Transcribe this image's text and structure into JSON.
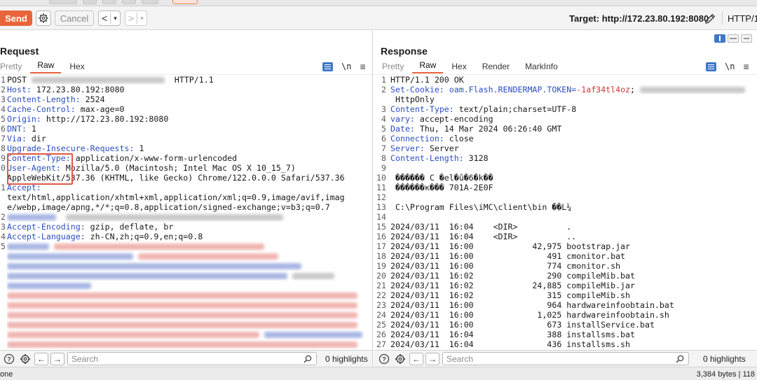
{
  "toolbar": {
    "send_label": "Send",
    "cancel_label": "Cancel",
    "back_label": "<",
    "back_dropdown": "▾",
    "forward_label": ">",
    "forward_dropdown": "▾",
    "target_text": "Target: http://172.23.80.192:8080",
    "http_version": "HTTP/1"
  },
  "request": {
    "title": "Request",
    "tabs": [
      {
        "label": "Pretty",
        "active": false
      },
      {
        "label": "Raw",
        "active": true
      },
      {
        "label": "Hex",
        "active": false
      }
    ],
    "newline_toggle": "\\n",
    "lines": [
      {
        "n": "1",
        "parts": [
          {
            "t": "POST ",
            "c": "hv"
          },
          {
            "blur": "gray",
            "w": 190
          },
          {
            "t": "  HTTP/1.1",
            "c": "hv"
          }
        ]
      },
      {
        "n": "2",
        "parts": [
          {
            "t": "Host:",
            "c": "hn"
          },
          {
            "t": " 172.23.80.192:8080",
            "c": "hv"
          }
        ]
      },
      {
        "n": "3",
        "parts": [
          {
            "t": "Content-Length:",
            "c": "hn"
          },
          {
            "t": " 2524",
            "c": "hv"
          }
        ]
      },
      {
        "n": "4",
        "parts": [
          {
            "t": "Cache-Control:",
            "c": "hn"
          },
          {
            "t": " max-age=0",
            "c": "hv"
          }
        ]
      },
      {
        "n": "5",
        "parts": [
          {
            "t": "Origin:",
            "c": "hn"
          },
          {
            "t": " http://172.23.80.192:8080",
            "c": "hv"
          }
        ]
      },
      {
        "n": "6",
        "parts": [
          {
            "t": "DNT:",
            "c": "hn"
          },
          {
            "t": " 1",
            "c": "hv"
          }
        ]
      },
      {
        "n": "7",
        "parts": [
          {
            "t": "Via:",
            "c": "hn"
          },
          {
            "t": " dir",
            "c": "hv"
          }
        ]
      },
      {
        "n": "8",
        "parts": [
          {
            "t": "Upgrade-Insecure-Requests:",
            "c": "hn"
          },
          {
            "t": " 1",
            "c": "hv"
          }
        ]
      },
      {
        "n": "9",
        "parts": [
          {
            "t": "Content-Type:",
            "c": "hn"
          },
          {
            "t": " application/x-www-form-urlencoded",
            "c": "hv"
          }
        ]
      },
      {
        "n": "0",
        "parts": [
          {
            "t": "User-Agent:",
            "c": "hn"
          },
          {
            "t": " Mozilla/5.0 (Macintosh; Intel Mac OS X 10_15_7)",
            "c": "hv"
          }
        ]
      },
      {
        "n": "",
        "parts": [
          {
            "t": "AppleWebKit/537.36 (KHTML, like Gecko) Chrome/122.0.0.0 Safari/537.36",
            "c": "hv"
          }
        ]
      },
      {
        "n": "1",
        "parts": [
          {
            "t": "Accept:",
            "c": "hn"
          }
        ]
      },
      {
        "n": "",
        "parts": [
          {
            "t": "text/html,application/xhtml+xml,application/xml;q=0.9,image/avif,imag",
            "c": "hv"
          }
        ]
      },
      {
        "n": "",
        "parts": [
          {
            "t": "e/webp,image/apng,*/*;q=0.8,application/signed-exchange;v=b3;q=0.7",
            "c": "hv"
          }
        ]
      },
      {
        "n": "2",
        "parts": [
          {
            "blur": "blue",
            "w": 70
          },
          {
            "t": "  ",
            "c": "hv"
          },
          {
            "blur": "gray",
            "w": 310
          }
        ]
      },
      {
        "n": "3",
        "parts": [
          {
            "t": "Accept-Encoding:",
            "c": "hn"
          },
          {
            "t": " gzip, deflate, br",
            "c": "hv"
          }
        ]
      },
      {
        "n": "4",
        "parts": [
          {
            "t": "Accept-Language:",
            "c": "hn"
          },
          {
            "t": " zh-CN,zh;q=0.9,en;q=0.8",
            "c": "hv"
          }
        ]
      },
      {
        "n": "5",
        "parts": [
          {
            "blur": "blue",
            "w": 60
          },
          {
            "t": " ",
            "c": "hv"
          },
          {
            "blur": "red",
            "w": 300
          }
        ]
      },
      {
        "n": "",
        "parts": [
          {
            "blur": "blue",
            "w": 180
          },
          {
            "t": " ",
            "c": "hv"
          },
          {
            "blur": "red",
            "w": 200
          }
        ]
      },
      {
        "n": "",
        "parts": [
          {
            "blur": "blue",
            "w": 420
          }
        ]
      },
      {
        "n": "",
        "parts": [
          {
            "blur": "blue",
            "w": 400
          },
          {
            "t": " ",
            "c": "hv"
          },
          {
            "blur": "gray",
            "w": 60
          }
        ]
      },
      {
        "n": "",
        "parts": [
          {
            "blur": "blue",
            "w": 120
          }
        ]
      },
      {
        "n": "",
        "parts": [
          {
            "blur": "red",
            "w": 500
          }
        ]
      },
      {
        "n": "",
        "parts": [
          {
            "blur": "red",
            "w": 500
          }
        ]
      },
      {
        "n": "",
        "parts": [
          {
            "blur": "red",
            "w": 500
          }
        ]
      },
      {
        "n": "",
        "parts": [
          {
            "blur": "red",
            "w": 500
          }
        ]
      },
      {
        "n": "",
        "parts": [
          {
            "blur": "red",
            "w": 360
          },
          {
            "t": " ",
            "c": "hv"
          },
          {
            "blur": "blue",
            "w": 140
          }
        ]
      },
      {
        "n": "",
        "parts": [
          {
            "blur": "red",
            "w": 500
          }
        ]
      },
      {
        "n": "",
        "parts": [
          {
            "blur": "red",
            "w": 500
          }
        ]
      }
    ]
  },
  "response": {
    "title": "Response",
    "tabs": [
      {
        "label": "Pretty",
        "active": false
      },
      {
        "label": "Raw",
        "active": true
      },
      {
        "label": "Hex",
        "active": false
      },
      {
        "label": "Render",
        "active": false
      },
      {
        "label": "MarkInfo",
        "active": false
      }
    ],
    "newline_toggle": "\\n",
    "lines": [
      {
        "n": "1",
        "parts": [
          {
            "t": "HTTP/1.1 200 OK",
            "c": "hv"
          }
        ]
      },
      {
        "n": "2",
        "parts": [
          {
            "t": "Set-Cookie:",
            "c": "hn"
          },
          {
            "t": " oam.Flash.RENDERMAP.TOKEN=",
            "c": "hn"
          },
          {
            "t": "-1af34tl4oz",
            "c": "cv"
          },
          {
            "t": "; ",
            "c": "hv"
          },
          {
            "blur": "gray",
            "w": 150
          }
        ]
      },
      {
        "n": "",
        "parts": [
          {
            "t": " HttpOnly",
            "c": "hv"
          }
        ]
      },
      {
        "n": "3",
        "parts": [
          {
            "t": "Content-Type:",
            "c": "hn"
          },
          {
            "t": " text/plain;charset=UTF-8",
            "c": "hv"
          }
        ]
      },
      {
        "n": "4",
        "parts": [
          {
            "t": "vary:",
            "c": "hn"
          },
          {
            "t": " accept-encoding",
            "c": "hv"
          }
        ]
      },
      {
        "n": "5",
        "parts": [
          {
            "t": "Date:",
            "c": "hn"
          },
          {
            "t": " Thu, 14 Mar 2024 06:26:40 GMT",
            "c": "hv"
          }
        ]
      },
      {
        "n": "6",
        "parts": [
          {
            "t": "Connection:",
            "c": "hn"
          },
          {
            "t": " close",
            "c": "hv"
          }
        ]
      },
      {
        "n": "7",
        "parts": [
          {
            "t": "Server:",
            "c": "hn"
          },
          {
            "t": " Server",
            "c": "hv"
          }
        ]
      },
      {
        "n": "8",
        "parts": [
          {
            "t": "Content-Length:",
            "c": "hn"
          },
          {
            "t": " 3128",
            "c": "hv"
          }
        ]
      },
      {
        "n": "9",
        "parts": []
      },
      {
        "n": "10",
        "parts": [
          {
            "t": " ������ C �el�û�6�k��",
            "c": "hv"
          }
        ]
      },
      {
        "n": "11",
        "parts": [
          {
            "t": " ������κ��� 701A-2E0F",
            "c": "hv"
          }
        ]
      },
      {
        "n": "12",
        "parts": []
      },
      {
        "n": "13",
        "parts": [
          {
            "t": " C:\\Program Files\\iMC\\client\\bin ��L¼",
            "c": "hv"
          }
        ]
      },
      {
        "n": "14",
        "parts": []
      },
      {
        "n": "15",
        "parts": [
          {
            "t": "2024/03/11  16:04    <DIR>          .",
            "c": "hv"
          }
        ]
      },
      {
        "n": "16",
        "parts": [
          {
            "t": "2024/03/11  16:04    <DIR>          ..",
            "c": "hv"
          }
        ]
      },
      {
        "n": "17",
        "parts": [
          {
            "t": "2024/03/11  16:00            42,975 bootstrap.jar",
            "c": "hv"
          }
        ]
      },
      {
        "n": "18",
        "parts": [
          {
            "t": "2024/03/11  16:00               491 cmonitor.bat",
            "c": "hv"
          }
        ]
      },
      {
        "n": "19",
        "parts": [
          {
            "t": "2024/03/11  16:00               774 cmonitor.sh",
            "c": "hv"
          }
        ]
      },
      {
        "n": "20",
        "parts": [
          {
            "t": "2024/03/11  16:02               290 compileMib.bat",
            "c": "hv"
          }
        ]
      },
      {
        "n": "21",
        "parts": [
          {
            "t": "2024/03/11  16:02            24,885 compileMib.jar",
            "c": "hv"
          }
        ]
      },
      {
        "n": "22",
        "parts": [
          {
            "t": "2024/03/11  16:02               315 compileMib.sh",
            "c": "hv"
          }
        ]
      },
      {
        "n": "23",
        "parts": [
          {
            "t": "2024/03/11  16:00               964 hardwareinfoobtain.bat",
            "c": "hv"
          }
        ]
      },
      {
        "n": "24",
        "parts": [
          {
            "t": "2024/03/11  16:00             1,025 hardwareinfoobtain.sh",
            "c": "hv"
          }
        ]
      },
      {
        "n": "25",
        "parts": [
          {
            "t": "2024/03/11  16:00               673 installService.bat",
            "c": "hv"
          }
        ]
      },
      {
        "n": "26",
        "parts": [
          {
            "t": "2024/03/11  16:04               388 installsms.bat",
            "c": "hv"
          }
        ]
      },
      {
        "n": "27",
        "parts": [
          {
            "t": "2024/03/11  16:04               436 installsms.sh",
            "c": "hv"
          }
        ]
      }
    ]
  },
  "request_footer": {
    "search_placeholder": "Search",
    "highlights": "0 highlights"
  },
  "response_footer": {
    "search_placeholder": "Search",
    "highlights": "0 highlights"
  },
  "status": {
    "left": "one",
    "right": "3,384 bytes | 118"
  },
  "colors": {
    "accent": "#e8643b",
    "header_name": "#2b4fc0",
    "cookie_value": "#d1342f",
    "annotation_box": "#e0584a"
  }
}
